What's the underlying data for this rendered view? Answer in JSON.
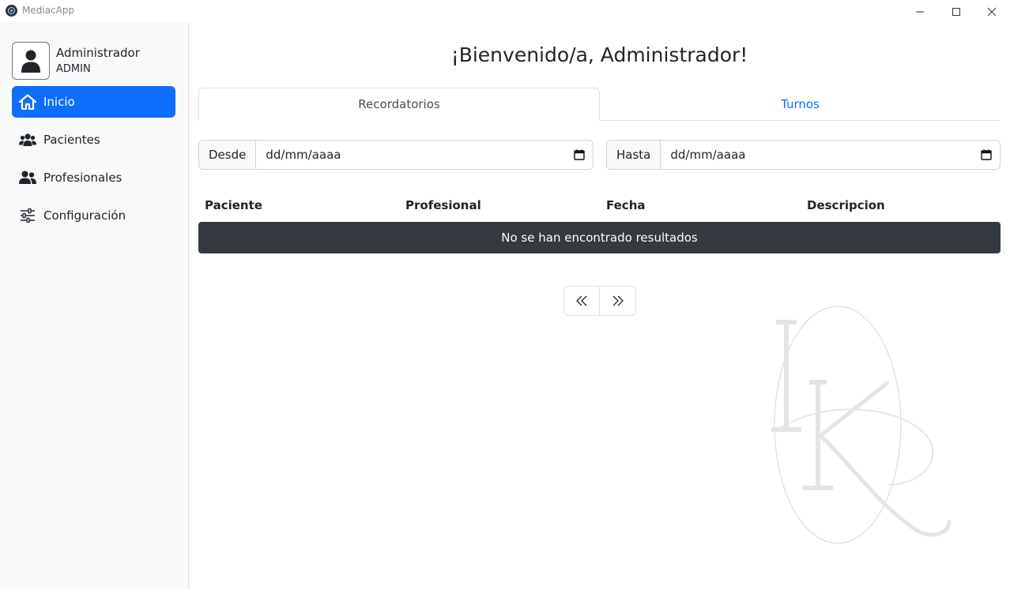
{
  "window": {
    "title": "MediacApp"
  },
  "user": {
    "name": "Administrador",
    "role": "ADMIN"
  },
  "sidebar": {
    "items": [
      {
        "label": "Inicio",
        "icon": "home-icon",
        "active": true
      },
      {
        "label": "Pacientes",
        "icon": "users-icon",
        "active": false
      },
      {
        "label": "Profesionales",
        "icon": "user-group-icon",
        "active": false
      },
      {
        "label": "Configuración",
        "icon": "sliders-icon",
        "active": false
      }
    ]
  },
  "main": {
    "title": "¡Bienvenido/a, Administrador!",
    "tabs": [
      {
        "label": "Recordatorios",
        "active": true
      },
      {
        "label": "Turnos",
        "active": false
      }
    ],
    "filters": {
      "from_label": "Desde",
      "from_placeholder": "dd/mm/aaaa",
      "to_label": "Hasta",
      "to_placeholder": "dd/mm/aaaa"
    },
    "table": {
      "columns": [
        "Paciente",
        "Profesional",
        "Fecha",
        "Descripcion"
      ],
      "empty_message": "No se han encontrado resultados"
    },
    "pager": {
      "prev_icon": "chevrons-left-icon",
      "next_icon": "chevrons-right-icon"
    }
  },
  "colors": {
    "accent": "#0d6efd",
    "sidebar_bg": "#f8f9fa",
    "empty_row_bg": "#343a40"
  }
}
